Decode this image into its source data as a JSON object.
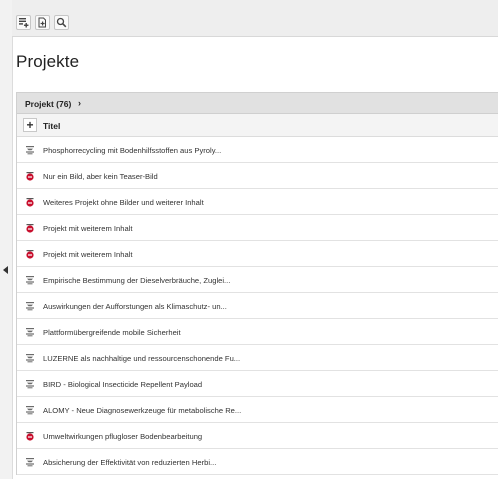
{
  "toolbar": {
    "buttons": [
      {
        "icon": "new-record-icon"
      },
      {
        "icon": "new-page-icon"
      },
      {
        "icon": "search-icon"
      }
    ]
  },
  "page": {
    "title": "Projekte"
  },
  "table": {
    "header_label": "Projekt (76)",
    "header_arrow": "›",
    "add_symbol": "+",
    "column_title": "Titel",
    "rows": [
      {
        "icon": "record-icon",
        "title": "Phosphorrecycling mit Bodenhilfsstoffen aus Pyroly..."
      },
      {
        "icon": "hidden-record-icon",
        "title": "Nur ein Bild, aber kein Teaser-Bild"
      },
      {
        "icon": "hidden-record-icon",
        "title": "Weiteres Projekt ohne Bilder und weiterer Inhalt"
      },
      {
        "icon": "hidden-record-icon",
        "title": "Projekt mit weiterem Inhalt"
      },
      {
        "icon": "hidden-record-icon",
        "title": "Projekt mit weiterem Inhalt"
      },
      {
        "icon": "record-icon",
        "title": "Empirische Bestimmung der Dieselverbräuche, Zuglei..."
      },
      {
        "icon": "record-icon",
        "title": "Auswirkungen der Aufforstungen als Klimaschutz- un..."
      },
      {
        "icon": "record-icon",
        "title": "Plattformübergreifende mobile Sicherheit"
      },
      {
        "icon": "record-icon",
        "title": "LUZERNE als nachhaltige und ressourcenschonende Fu..."
      },
      {
        "icon": "record-icon",
        "title": "BIRD - Biological Insecticide Repellent Payload"
      },
      {
        "icon": "record-icon",
        "title": "ALOMY - Neue Diagnosewerkzeuge für metabolische Re..."
      },
      {
        "icon": "hidden-record-icon",
        "title": "Umweltwirkungen pflugloser Bodenbearbeitung"
      },
      {
        "icon": "record-icon",
        "title": "Absicherung der Effektivität von reduzierten Herbi..."
      }
    ]
  },
  "colors": {
    "record_icon": "#6b6b6b",
    "hidden_icon_red": "#c8102e",
    "header_bg": "#e1e1e1",
    "toolbar_bg": "#eeeeee"
  }
}
